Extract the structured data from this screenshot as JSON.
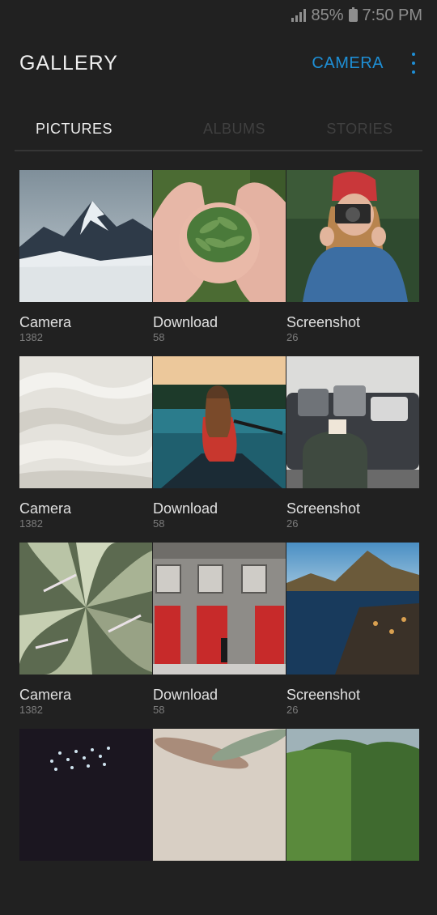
{
  "status": {
    "battery": "85%",
    "time": "7:50 PM"
  },
  "appbar": {
    "title": "GALLERY",
    "camera_label": "CAMERA"
  },
  "tabs": [
    {
      "label": "PICTURES",
      "active": true
    },
    {
      "label": "ALBUMS",
      "active": false
    },
    {
      "label": "STORIES",
      "active": false
    }
  ],
  "albums": [
    {
      "name": "Camera",
      "count": "1382",
      "thumb": "snowy-mountains"
    },
    {
      "name": "Download",
      "count": "58",
      "thumb": "hands-holding-greens"
    },
    {
      "name": "Screenshot",
      "count": "26",
      "thumb": "woman-with-camera"
    },
    {
      "name": "Camera",
      "count": "1382",
      "thumb": "white-fabric-waves"
    },
    {
      "name": "Download",
      "count": "58",
      "thumb": "woman-in-canoe"
    },
    {
      "name": "Screenshot",
      "count": "26",
      "thumb": "living-room-sofa"
    },
    {
      "name": "Camera",
      "count": "1382",
      "thumb": "succulent-leaves"
    },
    {
      "name": "Download",
      "count": "58",
      "thumb": "red-doors-building"
    },
    {
      "name": "Screenshot",
      "count": "26",
      "thumb": "coastal-village"
    },
    {
      "name": "",
      "count": "",
      "thumb": "dark-sparkles"
    },
    {
      "name": "",
      "count": "",
      "thumb": "dried-leaves"
    },
    {
      "name": "",
      "count": "",
      "thumb": "green-hills"
    }
  ]
}
